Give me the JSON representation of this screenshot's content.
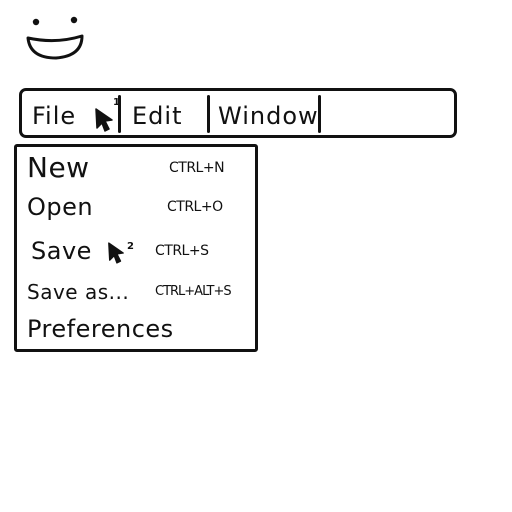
{
  "menubar": {
    "items": [
      {
        "label": "File",
        "cursor_badge": "1"
      },
      {
        "label": "Edit"
      },
      {
        "label": "Window"
      }
    ]
  },
  "file_menu": {
    "items": [
      {
        "label": "New",
        "shortcut": "CTRL+N"
      },
      {
        "label": "Open",
        "shortcut": "CTRL+O"
      },
      {
        "label": "Save",
        "shortcut": "CTRL+S",
        "cursor_badge": "2"
      },
      {
        "label": "Save as...",
        "shortcut": "CTRL+ALT+S"
      },
      {
        "label": "Preferences",
        "shortcut": ""
      }
    ]
  },
  "icons": {
    "mascot": "smiley-face-icon",
    "pointer": "mouse-pointer-icon"
  }
}
